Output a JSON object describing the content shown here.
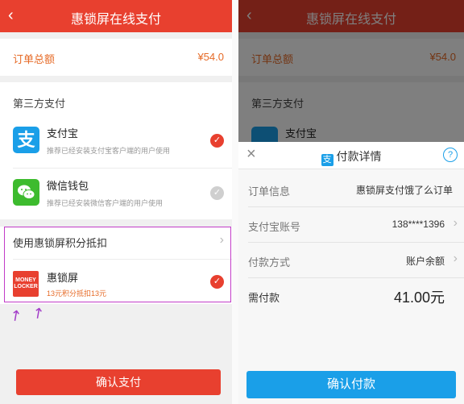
{
  "header": {
    "back_icon": "back-chevron-icon",
    "title": "惠锁屏在线支付"
  },
  "order": {
    "label": "订单总额",
    "amount": "¥54.0"
  },
  "third_party": {
    "title": "第三方支付",
    "methods": [
      {
        "name": "支付宝",
        "desc": "推荐已经安装支付宝客户端的用户使用",
        "icon": "alipay-icon",
        "icon_char": "支",
        "selected": true
      },
      {
        "name": "微信钱包",
        "desc": "推荐已经安装微信客户端的用户使用",
        "icon": "wechat-icon",
        "selected": false
      }
    ]
  },
  "points": {
    "title": "使用惠锁屏积分抵扣",
    "app_name": "惠锁屏",
    "logo_text": "MONEY LOCKER",
    "desc": "13元积分抵扣13元",
    "selected": true
  },
  "confirm_button": "确认支付",
  "alipay_sheet": {
    "title": "付款详情",
    "help": "?",
    "rows": [
      {
        "label": "订单信息",
        "value": "惠锁屏支付饿了么订单"
      },
      {
        "label": "支付宝账号",
        "value": "138****1396"
      },
      {
        "label": "付款方式",
        "value": "账户余额"
      }
    ],
    "due_label": "需付款",
    "due_value": "41.00元",
    "pay_button": "确认付款"
  },
  "colors": {
    "brand_red": "#e8402f",
    "orange_text": "#e66a26",
    "alipay_blue": "#1a9fe8",
    "highlight_purple": "#c23cc8"
  }
}
